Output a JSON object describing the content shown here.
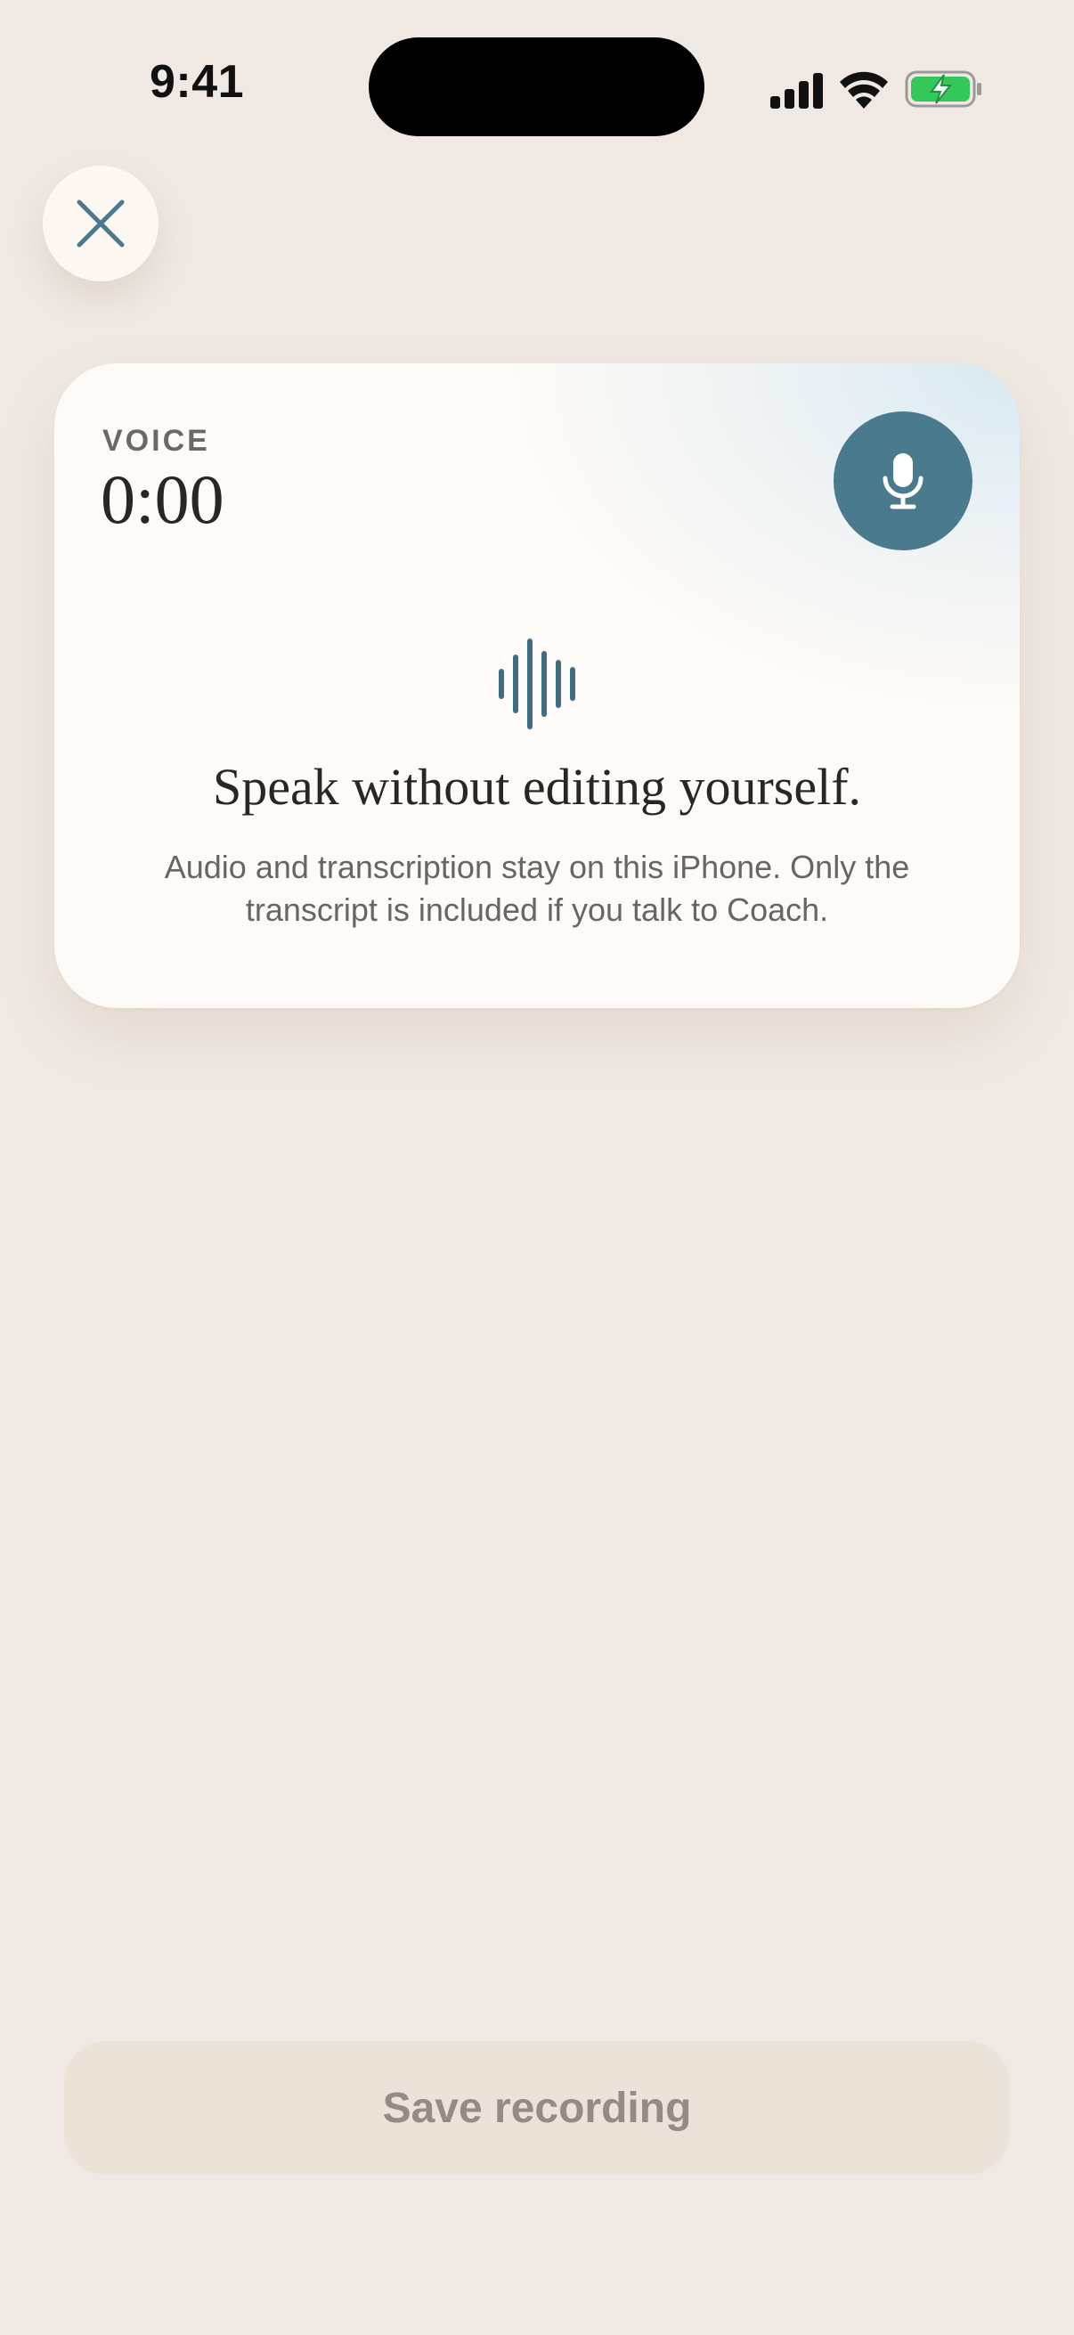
{
  "status_bar": {
    "time": "9:41",
    "icons": [
      "cellular-signal-icon",
      "wifi-icon",
      "battery-charging-icon"
    ],
    "battery_color": "#34c759"
  },
  "close_button": {
    "icon": "close-icon",
    "color": "#4a7a8e"
  },
  "voice_card": {
    "label": "VOICE",
    "timer": "0:00",
    "mic_icon": "microphone-icon",
    "wave_icon": "waveform-icon",
    "heading": "Speak without editing yourself.",
    "body": "Audio and transcription stay on this iPhone. Only the transcript is included if you talk to Coach.",
    "accent_color": "#4a7a8e"
  },
  "save_button": {
    "label": "Save recording",
    "enabled": false
  }
}
